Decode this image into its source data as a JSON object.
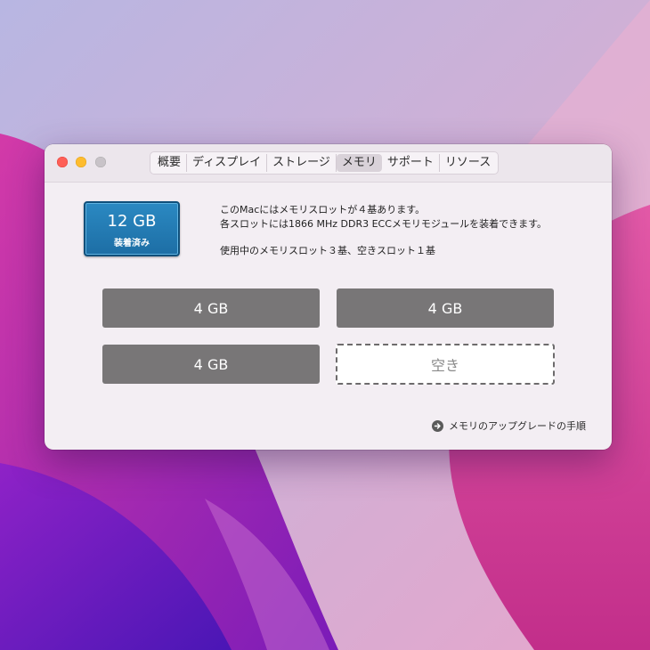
{
  "window": {
    "tabs": [
      {
        "label": "概要"
      },
      {
        "label": "ディスプレイ"
      },
      {
        "label": "ストレージ"
      },
      {
        "label": "メモリ"
      },
      {
        "label": "サポート"
      },
      {
        "label": "リソース"
      }
    ],
    "active_tab": "メモリ"
  },
  "memory": {
    "total": "12 GB",
    "installed_label": "装着済み",
    "info_lines": [
      "このMacにはメモリスロットが４基あります。",
      "各スロットには1866 MHz DDR3 ECCメモリモジュールを装着できます。"
    ],
    "usage_line": "使用中のメモリスロット３基、空きスロット１基",
    "slots": [
      {
        "label": "4 GB",
        "state": "filled"
      },
      {
        "label": "4 GB",
        "state": "filled"
      },
      {
        "label": "4 GB",
        "state": "filled"
      },
      {
        "label": "空き",
        "state": "empty"
      }
    ],
    "upgrade_link": "メモリのアップグレードの手順"
  },
  "icons": {
    "close": "close-light-icon",
    "minimize": "minimize-light-icon",
    "zoom": "zoom-light-icon",
    "upgrade": "arrow-right-circle-icon"
  },
  "colors": {
    "badge": "#2b89c2",
    "slot_filled": "#787677",
    "close": "#fe5f57",
    "minimize": "#febc2e"
  }
}
